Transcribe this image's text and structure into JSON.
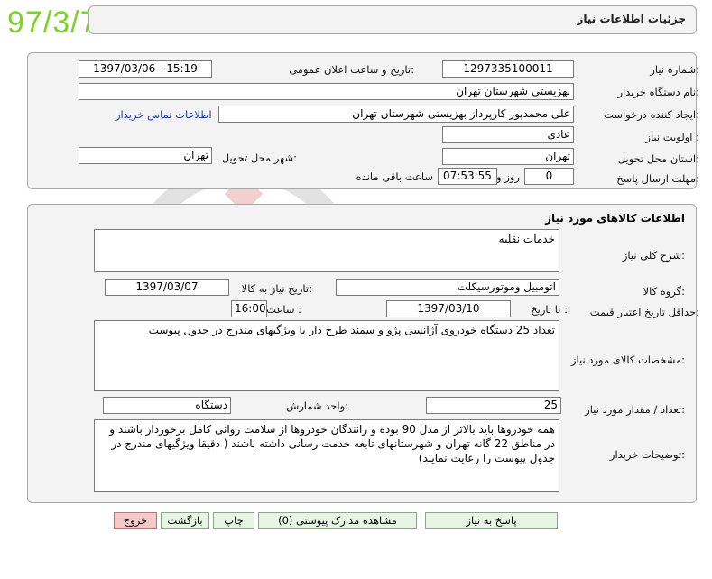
{
  "stamp": "97/3/7",
  "header": {
    "title": "جزئیات اطلاعات نیاز"
  },
  "details": {
    "need_number_label": "شماره نیاز:",
    "need_number": "1297335100011",
    "announce_label": "تاریخ و ساعت اعلان عمومی:",
    "announce_value": "1397/03/06 - 15:19",
    "buyer_label": "نام دستگاه خریدار:",
    "buyer_value": "بهزیستی شهرستان تهران",
    "creator_label": "ایجاد کننده درخواست:",
    "creator_value": "علی  محمدپور کارپرداز  بهزیستی شهرستان تهران",
    "contact_link": "اطلاعات تماس خریدار",
    "priority_label": "اولویت نیاز :",
    "priority_value": "عادی",
    "province_label": "استان محل تحویل:",
    "province_value": "تهران",
    "city_label": "شهر محل تحویل:",
    "city_value": "تهران",
    "deadline_label": "مهلت ارسال پاسخ:",
    "days_value": "0",
    "days_unit": "روز و",
    "time_value": "07:53:55",
    "remaining_label": "ساعت باقی مانده"
  },
  "goods": {
    "section_title": "اطلاعات کالاهای مورد نیاز",
    "summary_label": "شرح کلی نیاز:",
    "summary_value": "خدمات نقلیه",
    "group_label": "گروه کالا:",
    "group_value": "اتومبیل وموتورسیکلت",
    "need_date_label": "تاریخ نیاز به کالا:",
    "need_date_value": "1397/03/07",
    "validity_label": "حداقل تاریخ اعتبار قیمت:",
    "to_date_label": "تا تاریخ :",
    "to_date_value": "1397/03/10",
    "hour_label": "ساعت :",
    "hour_value": "16:00",
    "spec_label": "مشخصات کالای مورد نیاز:",
    "spec_value": "تعداد 25 دستگاه خودروی آژانسی پژو و سمند طرح دار با ویژگیهای مندرج در جدول پیوست",
    "qty_label": "تعداد / مقدار مورد نیاز:",
    "qty_value": "25",
    "unit_label": "واحد شمارش:",
    "unit_value": "دستگاه",
    "notes_label": "توضیحات خریدار:",
    "notes_value": "همه خودروها باید بالاتر از مدل 90 بوده و رانندگان خودروها از سلامت روانی کامل برخوردار باشند و در مناطق 22 گانه تهران و شهرستانهای تابعه خدمت رسانی داشته باشند ( دقیقا ویژگیهای مندرج در جدول پیوست را رعایت نمایند)"
  },
  "buttons": {
    "reply": "پاسخ به نیاز",
    "attachments": "مشاهده مدارک پیوستی (0)",
    "print": "چاپ",
    "back": "بازگشت",
    "exit": "خروج"
  }
}
